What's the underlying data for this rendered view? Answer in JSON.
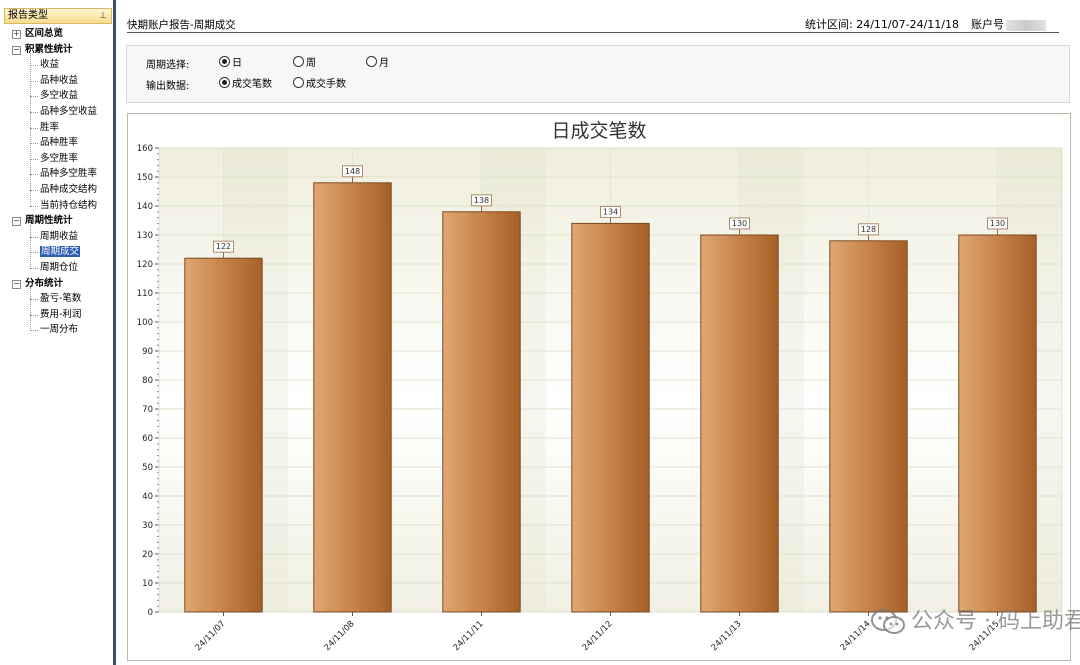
{
  "sidebar": {
    "header": "报告类型",
    "pin_icon": "pin-icon",
    "groups": [
      {
        "label": "区间总览",
        "expanded": false,
        "items": []
      },
      {
        "label": "积累性统计",
        "expanded": true,
        "items": [
          "收益",
          "品种收益",
          "多空收益",
          "品种多空收益",
          "胜率",
          "品种胜率",
          "多空胜率",
          "品种多空胜率",
          "品种成交结构",
          "当前持仓结构"
        ]
      },
      {
        "label": "周期性统计",
        "expanded": true,
        "items": [
          "周期收益",
          "周期成交",
          "周期仓位"
        ]
      },
      {
        "label": "分布统计",
        "expanded": true,
        "items": [
          "盈亏-笔数",
          "费用-利润",
          "一周分布"
        ]
      }
    ],
    "selected_item": "周期成交"
  },
  "header": {
    "report_title": "快期账户报告-周期成交",
    "range_text": "统计区间: 24/11/07-24/11/18",
    "account_text": "账户号"
  },
  "options": {
    "period_label": "周期选择:",
    "period_options": [
      "日",
      "周",
      "月"
    ],
    "period_selected": "日",
    "output_label": "输出数据:",
    "output_options": [
      "成交笔数",
      "成交手数"
    ],
    "output_selected": "成交笔数"
  },
  "chart_data": {
    "type": "bar",
    "title": "日成交笔数",
    "categories": [
      "24/11/07",
      "24/11/08",
      "24/11/11",
      "24/11/12",
      "24/11/13",
      "24/11/14",
      "24/11/15"
    ],
    "values": [
      122,
      148,
      138,
      134,
      130,
      128,
      130
    ],
    "ylim": [
      0,
      160
    ],
    "yticks": [
      0,
      10,
      20,
      30,
      40,
      50,
      60,
      70,
      80,
      90,
      100,
      110,
      120,
      130,
      140,
      150,
      160
    ],
    "xlabel": "",
    "ylabel": "",
    "bar_color": "#c5834a",
    "grid": true
  },
  "watermark": "公众号 · 码上助君"
}
